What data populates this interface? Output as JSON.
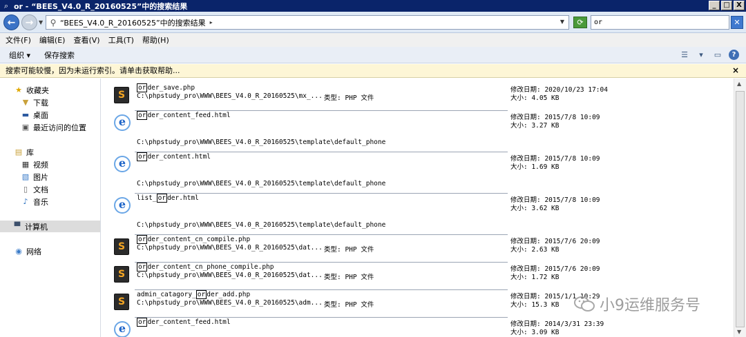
{
  "window": {
    "title": "or - “BEES_V4.0_R_20160525”中的搜索结果",
    "controls": [
      "_",
      "□",
      "X"
    ]
  },
  "address": {
    "text": "“BEES_V4.0_R_20160525”中的搜索结果",
    "search_value": "or"
  },
  "menu": [
    "文件(F)",
    "编辑(E)",
    "查看(V)",
    "工具(T)",
    "帮助(H)"
  ],
  "toolbar": {
    "organize": "组织 ▾",
    "save_search": "保存搜索"
  },
  "infobar": {
    "text": "搜索可能较慢，因为未运行索引。请单击获取帮助..."
  },
  "sidebar": {
    "favorites": "收藏夹",
    "downloads": "下载",
    "desktop": "桌面",
    "recent": "最近访问的位置",
    "libraries": "库",
    "videos": "视频",
    "pictures": "图片",
    "documents": "文档",
    "music": "音乐",
    "computer": "计算机",
    "network": "网络"
  },
  "results": [
    {
      "kind": "php",
      "pre": "",
      "hl": "or",
      "post": "der_save.php",
      "path": "C:\\phpstudy_pro\\WWW\\BEES_V4.0_R_20160525\\mx_...",
      "type": "类型: PHP 文件",
      "date": "修改日期: 2020/10/23 17:04",
      "size": "大小: 4.05 KB"
    },
    {
      "kind": "html",
      "pre": "",
      "hl": "or",
      "post": "der_content_feed.html",
      "path": "C:\\phpstudy_pro\\WWW\\BEES_V4.0_R_20160525\\template\\default_phone",
      "type": "",
      "date": "修改日期: 2015/7/8 10:09",
      "size": "大小: 3.27 KB"
    },
    {
      "kind": "html",
      "pre": "",
      "hl": "or",
      "post": "der_content.html",
      "path": "C:\\phpstudy_pro\\WWW\\BEES_V4.0_R_20160525\\template\\default_phone",
      "type": "",
      "date": "修改日期: 2015/7/8 10:09",
      "size": "大小: 1.69 KB"
    },
    {
      "kind": "html",
      "pre": "list_",
      "hl": "or",
      "post": "der.html",
      "path": "C:\\phpstudy_pro\\WWW\\BEES_V4.0_R_20160525\\template\\default_phone",
      "type": "",
      "date": "修改日期: 2015/7/8 10:09",
      "size": "大小: 3.62 KB"
    },
    {
      "kind": "php",
      "pre": "",
      "hl": "or",
      "post": "der_content_cn_compile.php",
      "path": "C:\\phpstudy_pro\\WWW\\BEES_V4.0_R_20160525\\dat...",
      "type": "类型: PHP 文件",
      "date": "修改日期: 2015/7/6 20:09",
      "size": "大小: 2.63 KB"
    },
    {
      "kind": "php",
      "pre": "",
      "hl": "or",
      "post": "der_content_cn_phone_compile.php",
      "path": "C:\\phpstudy_pro\\WWW\\BEES_V4.0_R_20160525\\dat...",
      "type": "类型: PHP 文件",
      "date": "修改日期: 2015/7/6 20:09",
      "size": "大小: 1.72 KB"
    },
    {
      "kind": "php",
      "pre": "admin_catagory_",
      "hl": "or",
      "post": "der_add.php",
      "path": "C:\\phpstudy_pro\\WWW\\BEES_V4.0_R_20160525\\adm...",
      "type": "类型: PHP 文件",
      "date": "修改日期: 2015/1/1 10:29",
      "size": "大小: 15.3 KB"
    },
    {
      "kind": "html",
      "pre": "",
      "hl": "or",
      "post": "der_content_feed.html",
      "path": "",
      "type": "",
      "date": "修改日期: 2014/3/31 23:39",
      "size": "大小: 3.09 KB"
    }
  ],
  "watermark": {
    "text": "小9运维服务号"
  },
  "colors": {
    "titlebar": "#0a246a",
    "infobar": "#fdf6d6",
    "selected": "#dcdcdc"
  }
}
